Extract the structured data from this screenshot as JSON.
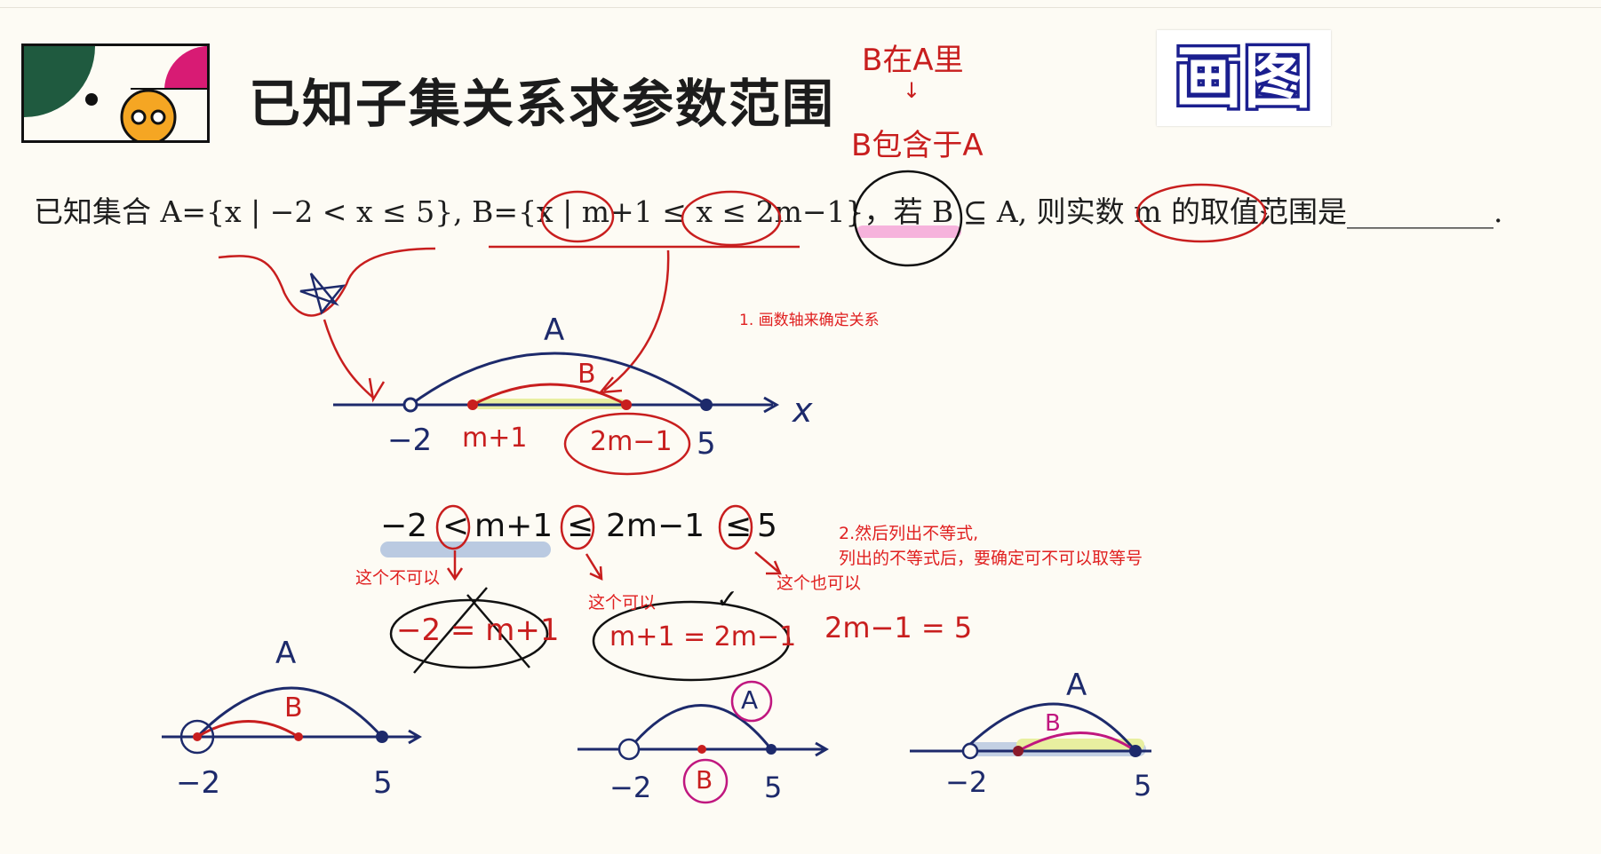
{
  "header": {
    "title": "已知子集关系求参数范围",
    "badge": "画图"
  },
  "problem": {
    "text": "已知集合 A={x | −2 < x ≤ 5}, B={x | m+1 ≤ x ≤ 2m−1}，若 B ⊆ A, 则实数 m 的取值范围是",
    "blank": "__________."
  },
  "handwriting": {
    "b_in_a": "B在A里",
    "arrow": "↓",
    "b_subset": "B包含于A",
    "label_A": "A",
    "label_B": "B",
    "axis_x": "x",
    "tick_neg2": "−2",
    "tick_m1": "m+1",
    "tick_2m1": "2m−1",
    "tick_5": "5",
    "ineq_a": "−2",
    "ineq_op1": "<",
    "ineq_b": "m+1",
    "ineq_op2": "≤",
    "ineq_c": "2m−1",
    "ineq_op3": "≤",
    "ineq_d": "5",
    "eq1": "−2 = m+1",
    "eq2": "m+1 = 2m−1",
    "eq3": "2m−1 = 5",
    "check": "✓"
  },
  "notes": {
    "step1": "1. 画数轴来确定关系",
    "step2_line1": "2.然后列出不等式,",
    "step2_line2": "列出的不等式后，要确定可不可以取等号",
    "not_ok": "这个不可以",
    "ok": "这个可以",
    "also_ok": "这个也可以"
  },
  "colors": {
    "ink_blue": "#1d2a6b",
    "ink_red": "#c81e1e",
    "note_red": "#e02020",
    "magenta": "#c0177f",
    "highlight_yellow": "#e8efa0",
    "highlight_pink": "#f4a6d7",
    "highlight_blue": "#a9bedc",
    "logo_green": "#1f5a3f",
    "logo_pink": "#d81b74",
    "logo_orange": "#f5a623"
  }
}
